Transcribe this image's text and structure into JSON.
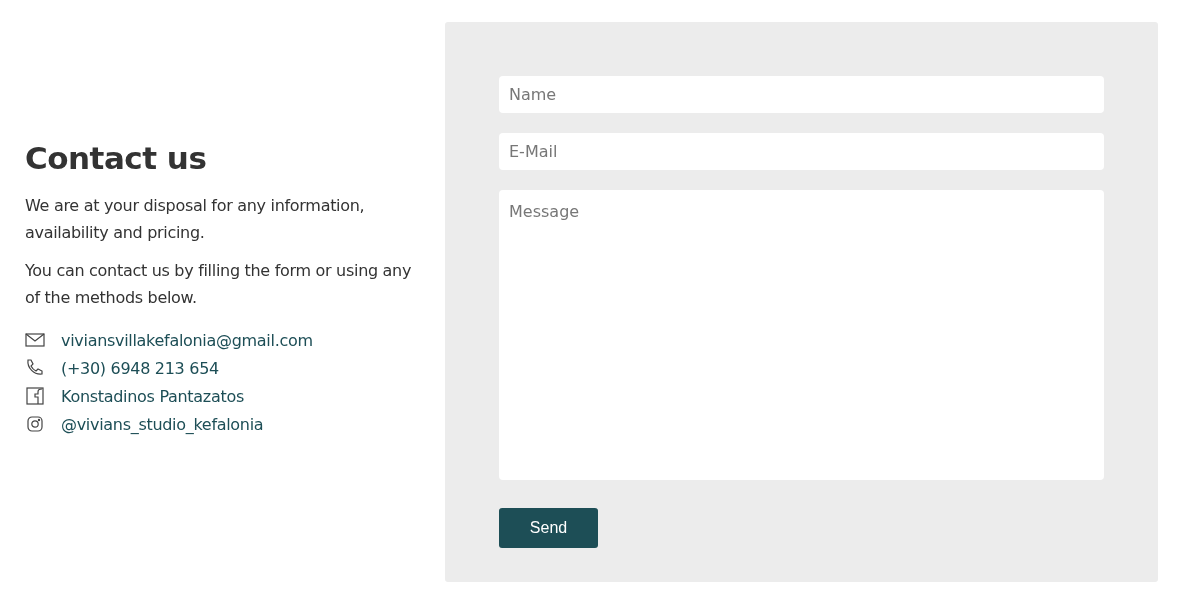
{
  "heading": "Contact us",
  "paragraphs": [
    "We are at your disposal for any information, availability and pricing.",
    "You can contact us by filling the form or using any of the methods below."
  ],
  "contacts": [
    {
      "kind": "email",
      "text": "viviansvillakefalonia@gmail.com"
    },
    {
      "kind": "phone",
      "text": "(+30) 6948 213 654"
    },
    {
      "kind": "facebook",
      "text": "Konstadinos Pantazatos"
    },
    {
      "kind": "instagram",
      "text": "@vivians_studio_kefalonia"
    }
  ],
  "form": {
    "fields": [
      {
        "kind": "text",
        "placeholder": "Name"
      },
      {
        "kind": "text",
        "placeholder": "E-Mail"
      },
      {
        "kind": "textarea",
        "placeholder": "Message"
      }
    ],
    "button": "Send"
  }
}
